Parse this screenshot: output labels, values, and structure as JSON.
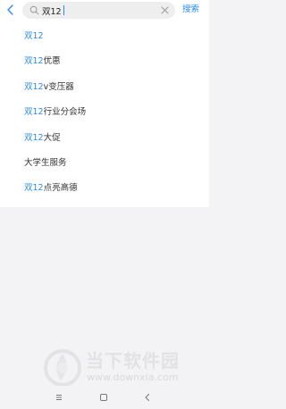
{
  "header": {
    "back_icon": "chevron-left-icon",
    "search_value": "双12",
    "clear_icon": "close-icon",
    "search_icon": "search-icon",
    "search_button": "搜索"
  },
  "suggestions": [
    {
      "highlight": "双12",
      "rest": ""
    },
    {
      "highlight": "双12",
      "rest": "优惠"
    },
    {
      "highlight": "双12",
      "rest": "v变压器"
    },
    {
      "highlight": "双12",
      "rest": "行业分会场"
    },
    {
      "highlight": "双12",
      "rest": "大促"
    },
    {
      "highlight": "",
      "rest": "大学生服务"
    },
    {
      "highlight": "双12",
      "rest": "点亮高德"
    }
  ],
  "watermark": {
    "title": "当下软件园",
    "url": "www.downxia.com"
  },
  "navbar": {
    "icons": [
      "menu-icon",
      "home-square-icon",
      "back-triangle-icon"
    ]
  },
  "colors": {
    "accent": "#2a8cf3",
    "background": "#f3f3f5",
    "panel": "#ffffff",
    "search_box": "#eeeeef"
  }
}
